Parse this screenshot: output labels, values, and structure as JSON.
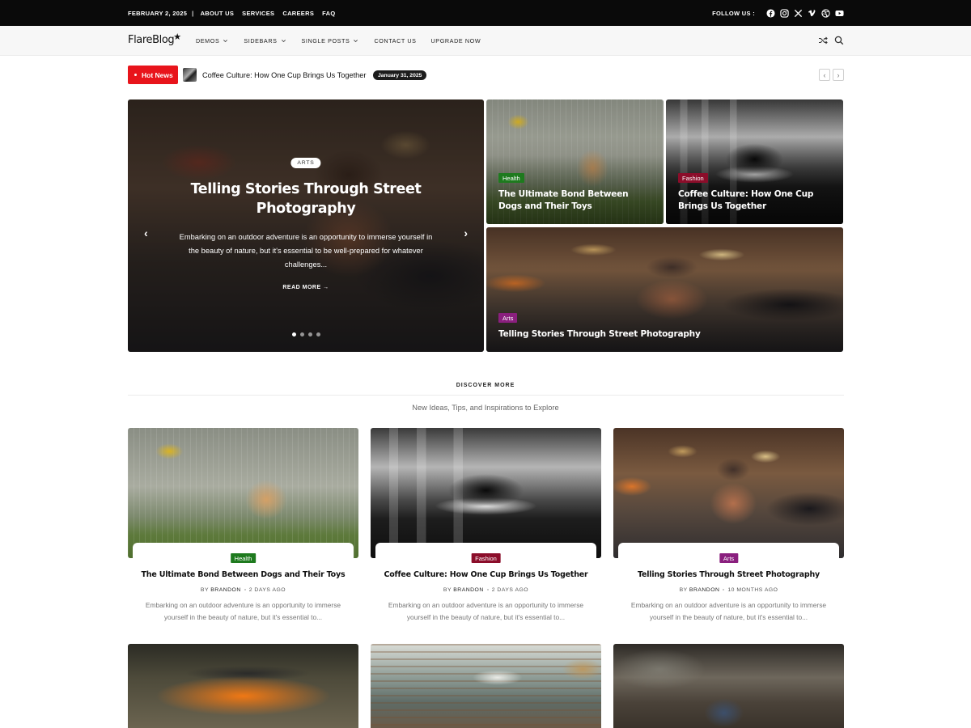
{
  "topbar": {
    "date": "FEBRUARY 2, 2025",
    "separator": "|",
    "links": [
      "ABOUT US",
      "SERVICES",
      "CAREERS",
      "FAQ"
    ],
    "follow_label": "FOLLOW US :",
    "social_icons": [
      "facebook-icon",
      "instagram-icon",
      "x-icon",
      "vimeo-icon",
      "dribbble-icon",
      "youtube-icon"
    ]
  },
  "nav": {
    "logo": "FlareBlog",
    "logo_star": "★",
    "menu": [
      {
        "label": "DEMOS",
        "dropdown": true
      },
      {
        "label": "SIDEBARS",
        "dropdown": true
      },
      {
        "label": "SINGLE POSTS",
        "dropdown": true
      },
      {
        "label": "CONTACT US",
        "dropdown": false
      },
      {
        "label": "UPGRADE NOW",
        "dropdown": false
      }
    ],
    "icons": [
      "shuffle-icon",
      "search-icon"
    ]
  },
  "ticker": {
    "badge": "Hot News",
    "title": "Coffee Culture: How One Cup Brings Us Together",
    "date": "January 31, 2025",
    "prev": "‹",
    "next": "›"
  },
  "hero": {
    "main": {
      "category": "ARTS",
      "title": "Telling Stories Through Street Photography",
      "excerpt": "Embarking on an outdoor adventure is an opportunity to immerse yourself in the beauty of nature, but it's essential to be well-prepared for whatever challenges...",
      "read_more": "READ MORE →",
      "prev": "‹",
      "next": "›",
      "slide_count": 4,
      "active_slide": 0
    },
    "tiles": [
      {
        "category": "Health",
        "title": "The Ultimate Bond Between Dogs and Their Toys",
        "color": "#1e7a1e"
      },
      {
        "category": "Fashion",
        "title": "Coffee Culture: How One Cup Brings Us Together",
        "color": "#8b0d2a"
      },
      {
        "category": "Arts",
        "title": "Telling Stories Through Street Photography",
        "color": "#8a1f7e"
      }
    ]
  },
  "discover": {
    "title": "DISCOVER MORE",
    "subtitle": "New Ideas, Tips, and Inspirations to Explore"
  },
  "cards": [
    {
      "category": "Health",
      "title": "The Ultimate Bond Between Dogs and Their Toys",
      "by": "BY",
      "author": "BRANDON",
      "time": "2 DAYS AGO",
      "excerpt": "Embarking on an outdoor adventure is an opportunity to immerse yourself in the beauty of nature, but it's essential to...",
      "color": "#1e7a1e"
    },
    {
      "category": "Fashion",
      "title": "Coffee Culture: How One Cup Brings Us Together",
      "by": "BY",
      "author": "BRANDON",
      "time": "2 DAYS AGO",
      "excerpt": "Embarking on an outdoor adventure is an opportunity to immerse yourself in the beauty of nature, but it's essential to...",
      "color": "#8b0d2a"
    },
    {
      "category": "Arts",
      "title": "Telling Stories Through Street Photography",
      "by": "BY",
      "author": "BRANDON",
      "time": "10 MONTHS AGO",
      "excerpt": "Embarking on an outdoor adventure is an opportunity to immerse yourself in the beauty of nature, but it's essential to...",
      "color": "#8a1f7e"
    }
  ],
  "colors": {
    "accent": "#e8141b",
    "topbar": "#0a0a0a",
    "navbar": "#f7f7f7"
  }
}
